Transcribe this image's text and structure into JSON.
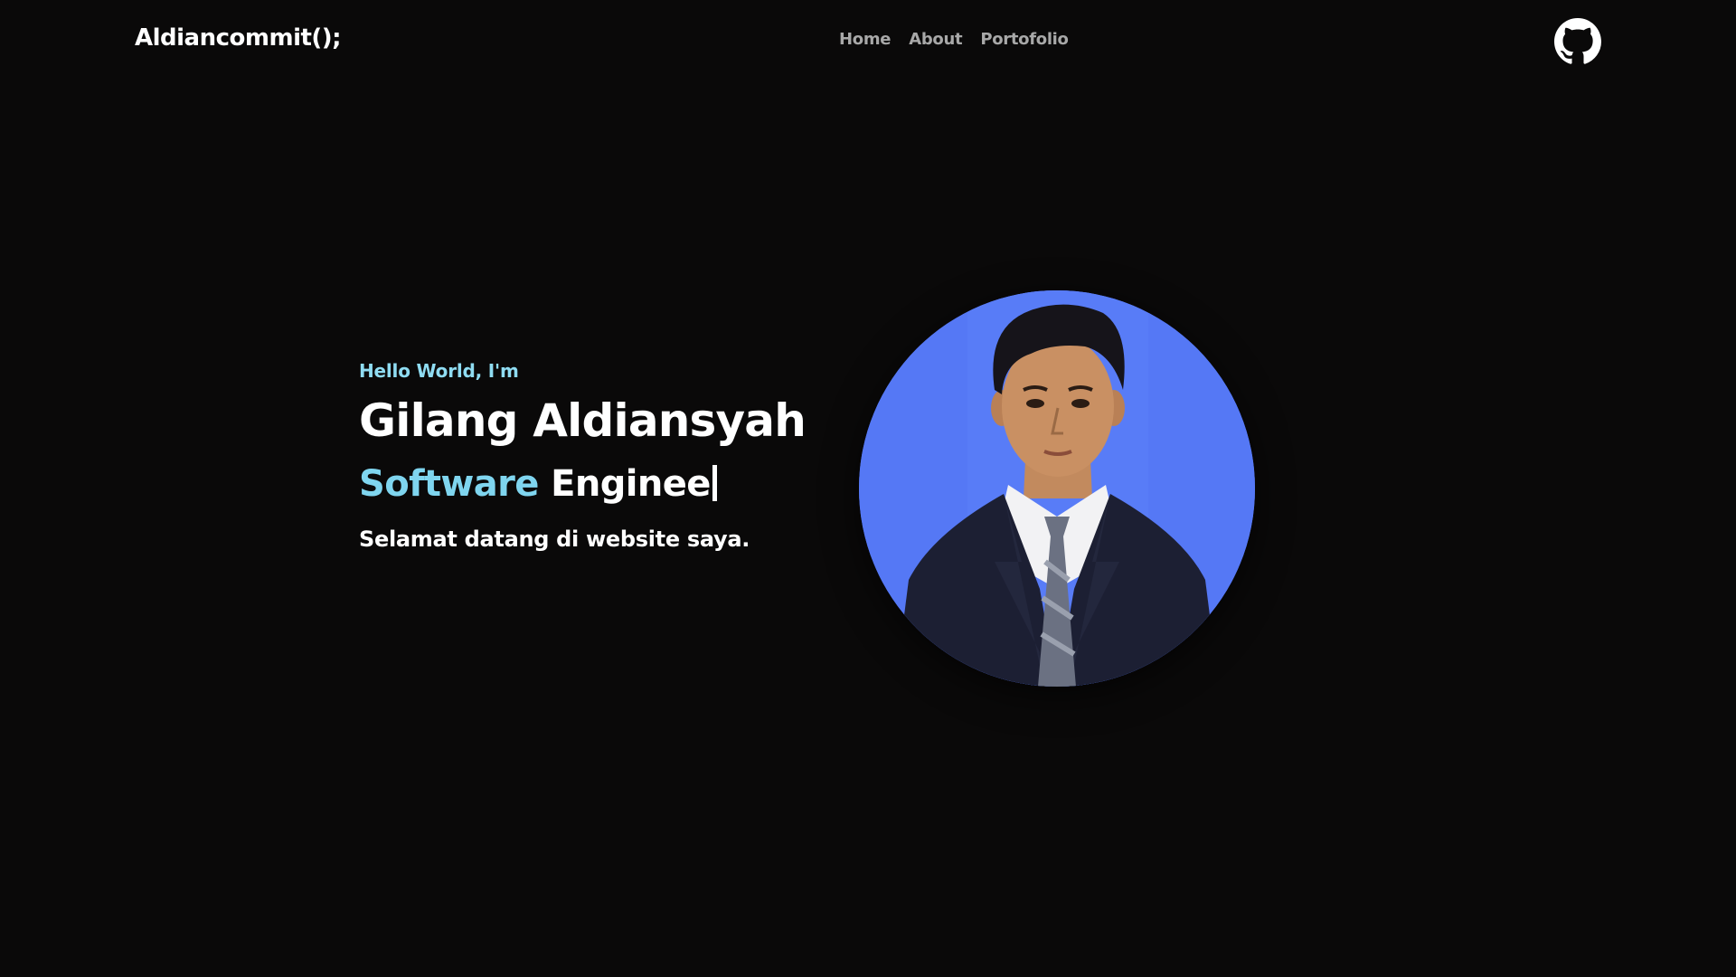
{
  "nav": {
    "brand": "Aldiancommit();",
    "links": [
      {
        "label": "Home"
      },
      {
        "label": "About"
      },
      {
        "label": "Portofolio"
      }
    ],
    "github_icon": "github-icon"
  },
  "hero": {
    "greeting": "Hello World, I'm",
    "name": "Gilang Aldiansyah",
    "role_highlight": "Software",
    "role_rest": " Enginee",
    "subtitle": "Selamat datang di website saya.",
    "photo": "portrait-photo"
  },
  "colors": {
    "background": "#0a0909",
    "accent": "#8fdcf2",
    "nav_link": "#a8a8a8",
    "photo_bg": "#5578f5"
  }
}
